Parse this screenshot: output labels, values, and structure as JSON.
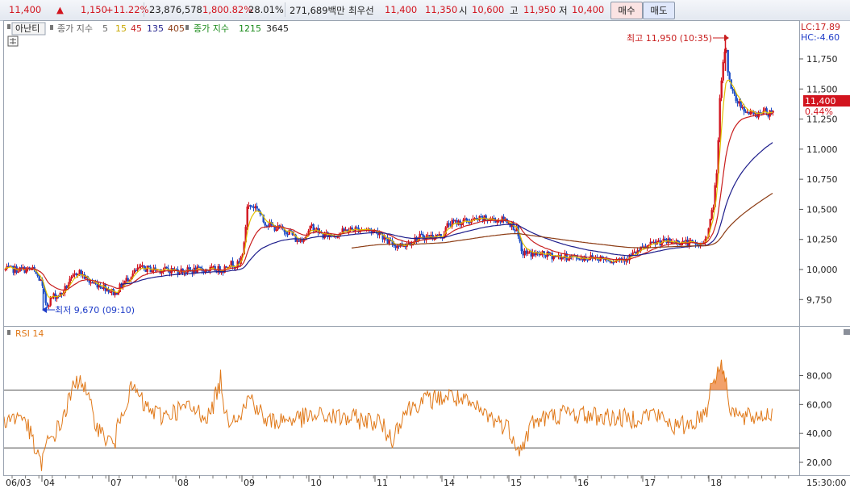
{
  "topbar": {
    "price": "11,400",
    "arrow": "▲",
    "change": "1,150",
    "change_pct": "+11.22%",
    "volume": "23,876,578",
    "volume_ratio": "1,800.82%",
    "turnover": "28.01%",
    "trade_value": "271,689백만",
    "best_quote_label": "최우선",
    "best_ask": "11,400",
    "best_bid": "11,350",
    "open_label": "시",
    "open": "10,600",
    "high_label": "고",
    "high": "11,950",
    "low_label": "저",
    "low": "10,400",
    "buy_label": "매수",
    "sell_label": "매도"
  },
  "legend": {
    "analysis_tab": "아난티",
    "ma_label": "종가 지수",
    "ma_periods": [
      "5",
      "15",
      "45",
      "135",
      "405"
    ],
    "ma_colors": [
      "#c8a800",
      "#c81e1e",
      "#1e1e8c",
      "#8c3c14",
      "#8c3c14"
    ],
    "ma2_label": "종가 지수",
    "ma2_periods": [
      "1215",
      "3645"
    ],
    "ma2_colors": [
      "#198a19",
      "#222222"
    ]
  },
  "right_panel": {
    "lc": "LC:17.89",
    "hc": "HC:-4.60",
    "current_price": "11,400",
    "current_pct": "0.44%"
  },
  "annotations": {
    "high": "최고 11,950 (10:35)",
    "low": "최저 9,670 (09:10)"
  },
  "time_axis": {
    "labels": [
      "06/03",
      "04",
      "07",
      "08",
      "09",
      "10",
      "11",
      "14",
      "15",
      "16",
      "17",
      "18"
    ],
    "end_time": "15:30:00"
  },
  "colors": {
    "up": "#d2141e",
    "down": "#1f4fc8",
    "rsi": "#e07818",
    "rsi_fill": "#f09050",
    "ma5": "#e0c000",
    "ma15": "#c81e1e",
    "ma45": "#1e1e8c",
    "ma135": "#8c3c14"
  },
  "chart_data": [
    {
      "type": "candlestick",
      "title": "",
      "y_ticks": [
        9750,
        10000,
        10250,
        10500,
        10750,
        11000,
        11250,
        11500,
        11750
      ],
      "y_tick_labels": [
        "9,750",
        "10,000",
        "10,250",
        "10,500",
        "10,750",
        "11,000",
        "11,250",
        "11,500",
        "11,750"
      ],
      "ylim": [
        9550,
        12000
      ],
      "x": [
        "06/03",
        "04",
        "07",
        "08",
        "09",
        "10",
        "11",
        "14",
        "15",
        "16",
        "17",
        "18"
      ],
      "close_approx": [
        10000,
        9800,
        9880,
        10010,
        10450,
        10310,
        10260,
        10380,
        10130,
        10100,
        10230,
        11400
      ],
      "high": 11950,
      "low": 9670,
      "last": 11400
    },
    {
      "type": "line",
      "title": "RSI 14",
      "series": [
        {
          "name": "RSI 14",
          "values": [
            50,
            34,
            62,
            50,
            62,
            58,
            48,
            56,
            46,
            48,
            50,
            89,
            52
          ]
        }
      ],
      "y_ticks": [
        20,
        40,
        60,
        80
      ],
      "y_tick_labels": [
        "20,00",
        "40,00",
        "60,00",
        "80,00"
      ],
      "ylim": [
        12,
        92
      ],
      "guides": [
        30,
        70
      ]
    }
  ]
}
